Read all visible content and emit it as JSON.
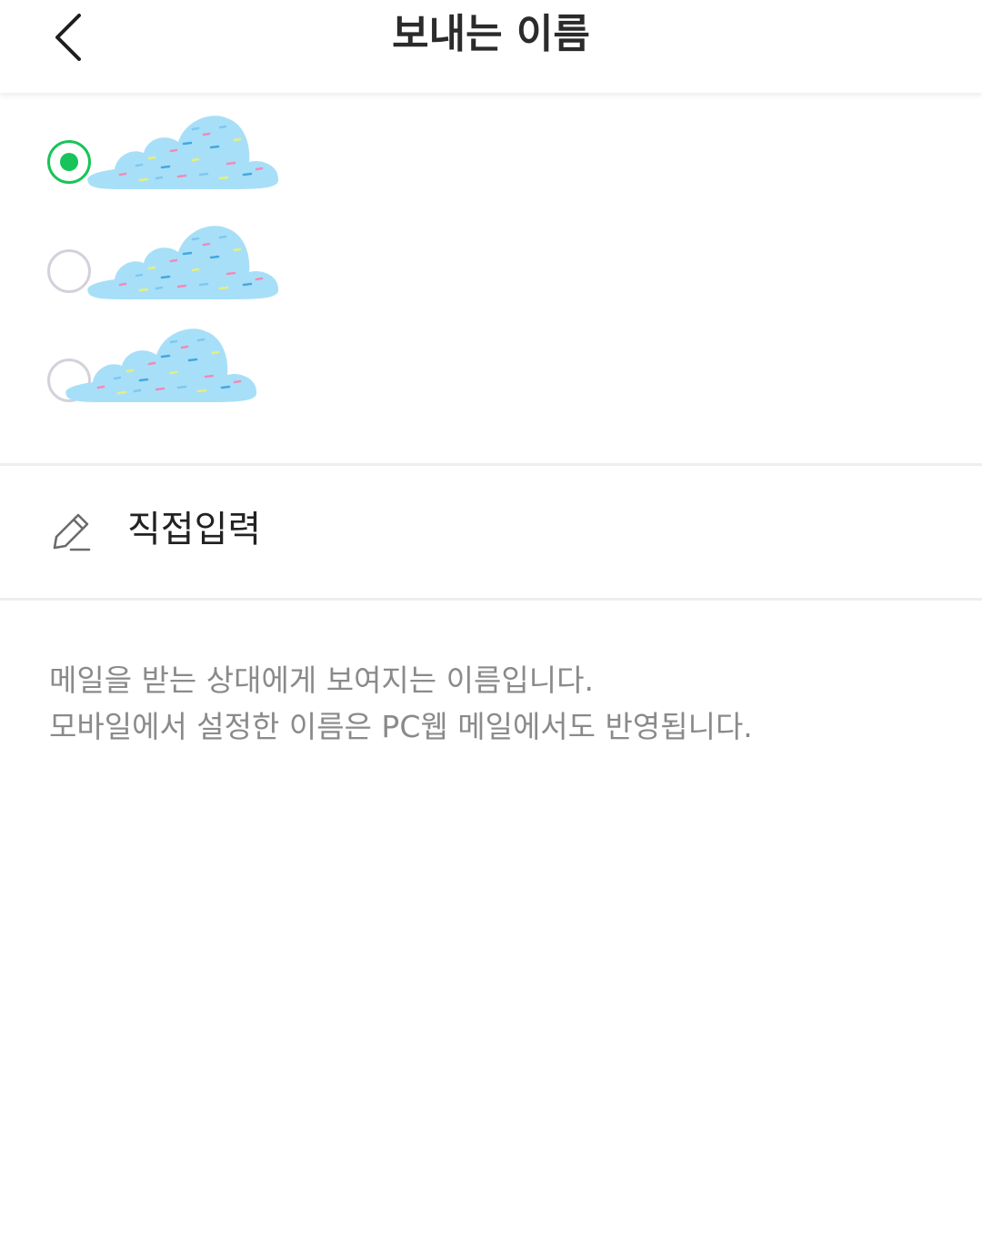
{
  "header": {
    "title": "보내는 이름",
    "back_icon": "chevron-left-icon"
  },
  "name_options": [
    {
      "selected": true
    },
    {
      "selected": false
    },
    {
      "selected": false
    }
  ],
  "direct_input": {
    "label": "직접입력",
    "icon": "pencil-icon"
  },
  "description": {
    "line1": "메일을 받는 상대에게 보여지는 이름입니다.",
    "line2": "모바일에서 설정한 이름은 PC웹 메일에서도 반영됩니다."
  },
  "colors": {
    "accent": "#18c45a",
    "cloud": "#a8dff8"
  }
}
